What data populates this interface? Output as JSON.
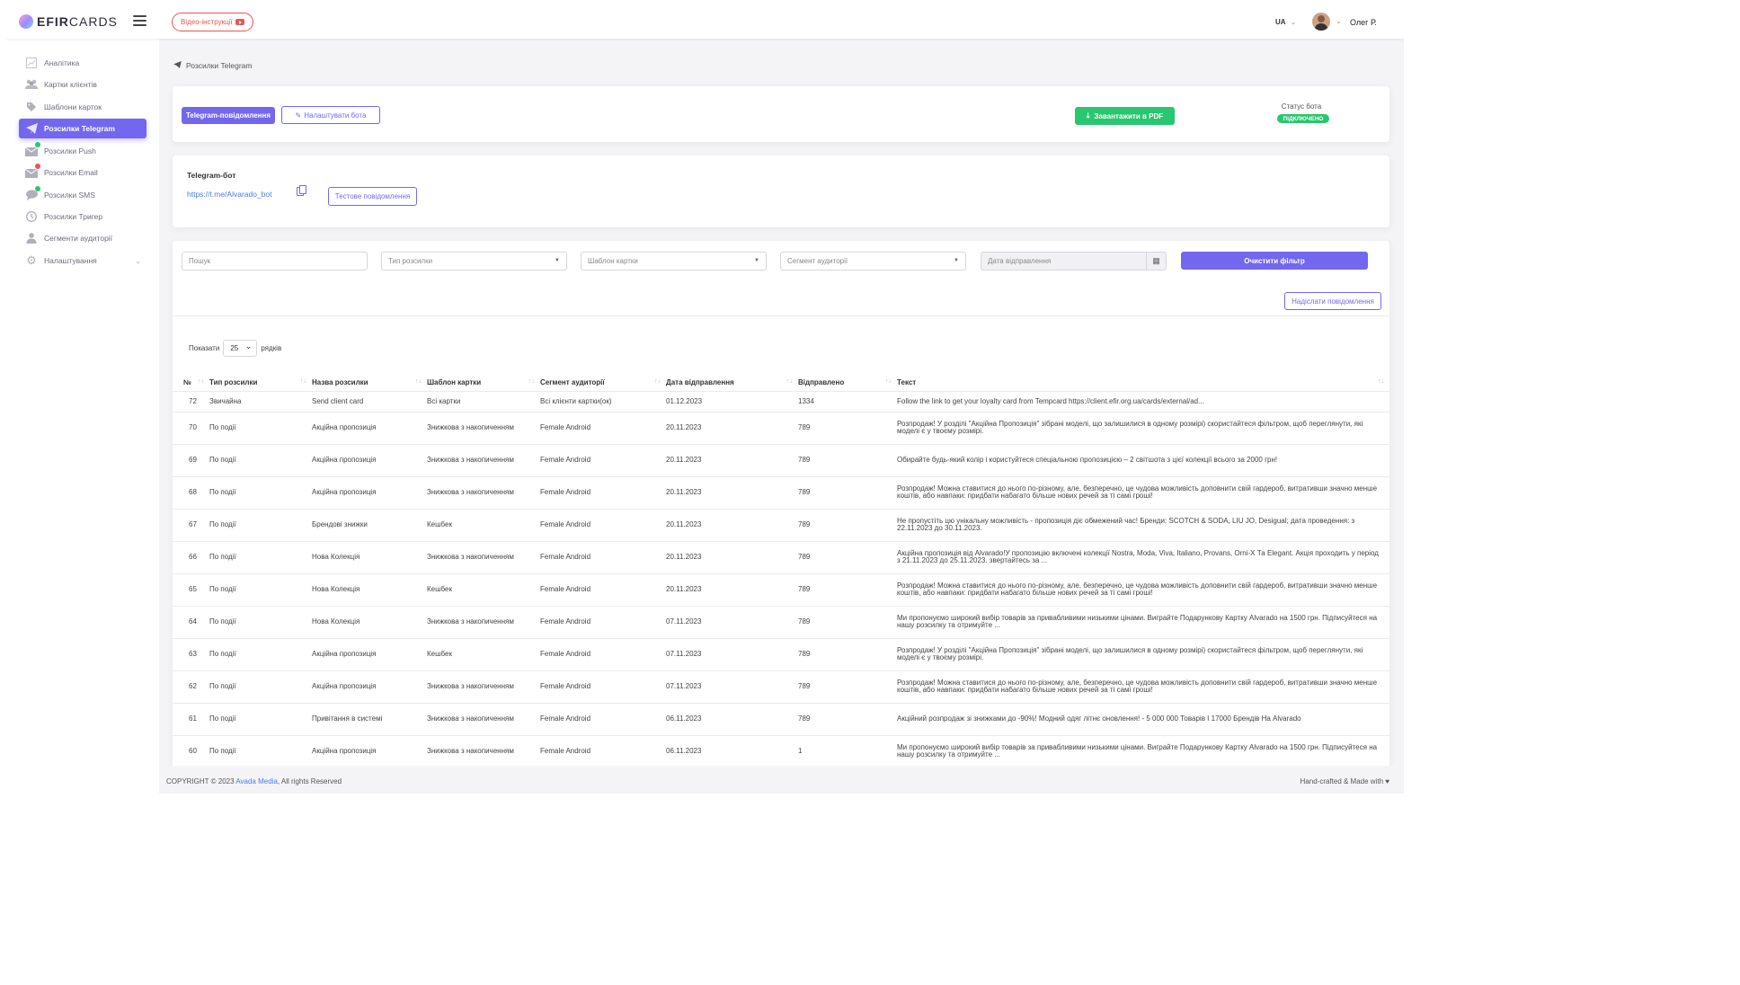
{
  "header": {
    "logo_bold": "EFIR",
    "logo_rest": "CARDS",
    "video_button": "Відео-інструкції",
    "lang": "UA",
    "user_name": "Олег Р."
  },
  "sidebar": {
    "items": [
      {
        "label": "Аналітика",
        "icon": "chart-icon"
      },
      {
        "label": "Картки клієнтів",
        "icon": "users-icon"
      },
      {
        "label": "Шаблони карток",
        "icon": "tag-icon"
      },
      {
        "label": "Розсилки Telegram",
        "icon": "send-icon",
        "active": true
      },
      {
        "label": "Розсилки Push",
        "icon": "mail-icon",
        "dot": "#28c76f"
      },
      {
        "label": "Розсилки Email",
        "icon": "mail-icon",
        "dot": "#ea5455"
      },
      {
        "label": "Розсилки SMS",
        "icon": "chat-icon",
        "dot": "#28c76f"
      },
      {
        "label": "Розсилки Тригер",
        "icon": "clock-icon"
      },
      {
        "label": "Сегменти аудиторії",
        "icon": "user-icon"
      },
      {
        "label": "Налаштування",
        "icon": "gear-icon"
      }
    ]
  },
  "breadcrumb": "Розсилки Telegram",
  "toolbar": {
    "telegram_messages": "Telegram-повідомлення",
    "bot_settings": "Налаштувати бота",
    "download_pdf": "Завантажити в PDF",
    "status_label": "Статус бота",
    "status_value": "ПІДКЛЮЧЕНО"
  },
  "bot": {
    "title": "Telegram-бот",
    "link": "https://t.me/Alvarado_bot",
    "test_button": "Тестове повідомлення"
  },
  "filters": {
    "search_placeholder": "Пошук",
    "type": "Тип розсилки",
    "template": "Шаблон картки",
    "segment": "Сегмент аудиторії",
    "date": "Дата відправлення",
    "clear": "Очистити фільтр",
    "send_message": "Надіслати повідомлення",
    "show_label": "Показати",
    "page_size": "25",
    "rows_label": "рядків"
  },
  "table": {
    "columns": [
      "№",
      "Тип розсилки",
      "Назва розсилки",
      "Шаблон картки",
      "Сегмент аудиторії",
      "Дата відправлення",
      "Відправлено",
      "Текст"
    ],
    "rows": [
      [
        "72",
        "Звичайна",
        "Send client card",
        "Всі картки",
        "Всі клієнти картки(ок)",
        "01.12.2023",
        "1334",
        "Follow the link to get your loyalty card from Tempcard https://client.efir.org.ua/cards/external/ad..."
      ],
      [
        "70",
        "По події",
        "Акційна пропозиція",
        "Знижкова з накопиченням",
        "Female Android",
        "20.11.2023",
        "789",
        "Розпродаж! У розділі \"Акційна Пропозиція\" зібрані моделі, що залишилися в одному розмірі) скористайтеся фільтром, щоб переглянути, які моделі є у твоєму розмірі."
      ],
      [
        "69",
        "По події",
        "Акційна пропозиція",
        "Знижкова з накопиченням",
        "Female Android",
        "20.11.2023",
        "789",
        "Обирайте будь-який колір і користуйтеся спеціальною пропозицією – 2 світшота з цієї колекції всього за 2000 грн!"
      ],
      [
        "68",
        "По події",
        "Акційна пропозиція",
        "Знижкова з накопиченням",
        "Female Android",
        "20.11.2023",
        "789",
        "Розпродаж! Можна ставитися до нього по-різному, але, безперечно, це чудова можливість доповнити свій гардероб, витративши значно менше коштів, або навпаки: придбати набагато більше нових речей за ті самі гроші!"
      ],
      [
        "67",
        "По події",
        "Брендові знижки",
        "Кешбек",
        "Female Android",
        "20.11.2023",
        "789",
        "Не пропустіть цю унікальну можливість - пропозиція діє обмежений час! Бренди: SCOTCH & SODA, LIU JO, Desigual; дата проведення: з 22.11.2023 до 30.11.2023."
      ],
      [
        "66",
        "По події",
        "Нова Колекція",
        "Знижкова з накопиченням",
        "Female Android",
        "20.11.2023",
        "789",
        "Акційна пропозиція від Alvarado!У пропозицію включені колекції Nostra, Moda, Viva, Italiano, Provans, Orni-X Та Elegant. Акція проходить у період з 21.11.2023 до 25.11.2023. звертайтесь за ..."
      ],
      [
        "65",
        "По події",
        "Нова Колекція",
        "Кешбек",
        "Female Android",
        "20.11.2023",
        "789",
        "Розпродаж! Можна ставитися до нього по-різному, але, безперечно, це чудова можливість доповнити свій гардероб, витративши значно менше коштів, або навпаки: придбати набагато більше нових речей за ті самі гроші!"
      ],
      [
        "64",
        "По події",
        "Нова Колекція",
        "Знижкова з накопиченням",
        "Female Android",
        "07.11.2023",
        "789",
        "Ми пропонуємо широкий вибір товарів за привабливими низькими цінами. Виграйте Подарункову Картку Alvarado на 1500 грн. Підписуйтеся на нашу розсилку та отримуйте ..."
      ],
      [
        "63",
        "По події",
        "Акційна пропозиція",
        "Кешбек",
        "Female Android",
        "07.11.2023",
        "789",
        "Розпродаж! У розділі \"Акційна Пропозиція\" зібрані моделі, що залишилися в одному розмірі) скористайтеся фільтром, щоб переглянути, які моделі є у твоєму розмірі."
      ],
      [
        "62",
        "По події",
        "Акційна пропозиція",
        "Знижкова з накопиченням",
        "Female Android",
        "07.11.2023",
        "789",
        "Розпродаж! Можна ставитися до нього по-різному, але, безперечно, це чудова можливість доповнити свій гардероб, витративши значно менше коштів, або навпаки: придбати набагато більше нових речей за ті самі гроші!"
      ],
      [
        "61",
        "По події",
        "Привітання в системі",
        "Знижкова з накопиченням",
        "Female Android",
        "06.11.2023",
        "789",
        "Акційний розпродаж зі знижками до -90%! Модний одяг літнє оновлення! - 5 000 000 Товарів І 17000 Брендів На Alvarado"
      ],
      [
        "60",
        "По події",
        "Акційна пропозиція",
        "Знижкова з накопиченням",
        "Female Android",
        "06.11.2023",
        "1",
        "Ми пропонуємо широкий вибір товарів за привабливими низькими цінами. Виграйте Подарункову Картку Alvarado на 1500 грн. Підписуйтеся на нашу розсилку та отримуйте ..."
      ]
    ]
  },
  "footer": {
    "copyright": "COPYRIGHT © 2023",
    "company": "Avada Media",
    "rights": ", All rights Reserved",
    "made": "Hand-crafted & Made with ♥"
  }
}
